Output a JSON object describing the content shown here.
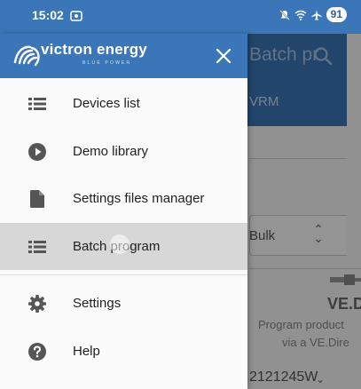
{
  "status_bar": {
    "time": "15:02",
    "battery": "91",
    "icons": [
      "screen-record-icon",
      "mute-icon",
      "wifi-icon",
      "airplane-icon"
    ]
  },
  "background": {
    "title": "Batch pr",
    "vrm_tab": "VRM",
    "select_value": "Bulk",
    "card_title": "VE.Dir",
    "card_line1": "Program product",
    "card_line2": "via a VE.Dire",
    "serial": "2121245W"
  },
  "drawer": {
    "brand": "victron energy",
    "tagline": "BLUE POWER",
    "items": [
      {
        "label": "Devices list",
        "icon": "list-icon"
      },
      {
        "label": "Demo library",
        "icon": "play-circle-icon"
      },
      {
        "label": "Settings files manager",
        "icon": "file-icon"
      },
      {
        "label": "Batch program",
        "icon": "list-icon"
      },
      {
        "label": "Settings",
        "icon": "gear-icon"
      },
      {
        "label": "Help",
        "icon": "help-circle-icon"
      }
    ],
    "selected_index": 3
  },
  "colors": {
    "brand_blue": "#3b77b8",
    "selected_bg": "#d7d7d7",
    "icon_gray": "#555555"
  }
}
